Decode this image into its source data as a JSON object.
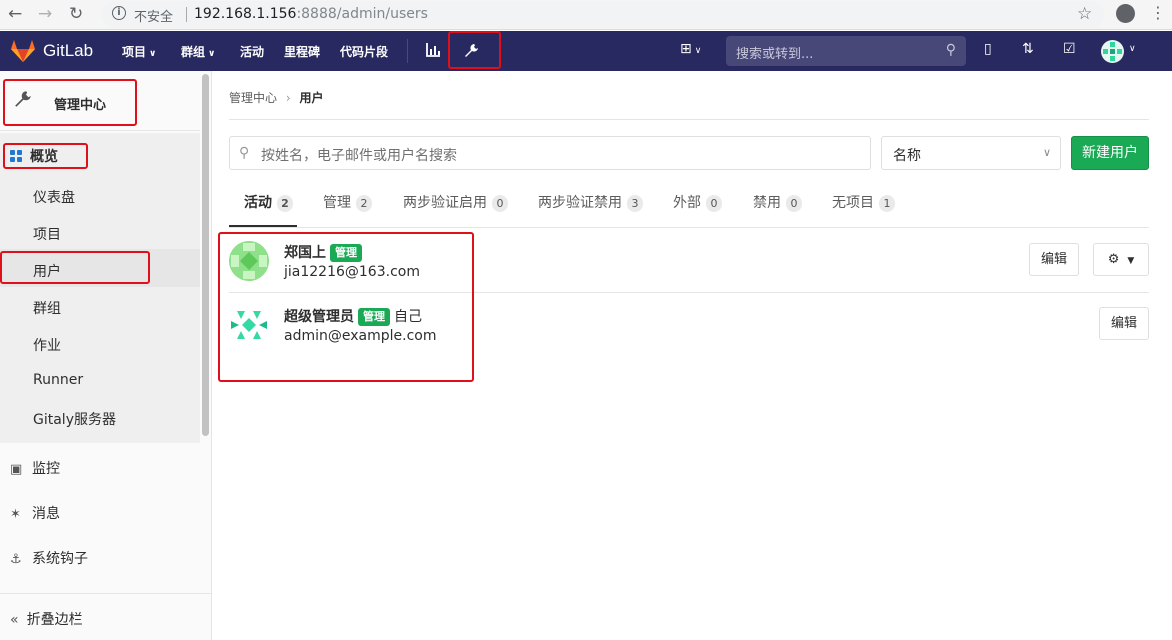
{
  "browser": {
    "back_icon": "arrow-left-icon",
    "forward_icon": "arrow-right-icon",
    "reload_icon": "reload-icon",
    "security_label": "不安全",
    "url_host": "192.168.1.156",
    "url_rest": ":8888/admin/users"
  },
  "header": {
    "brand": "GitLab",
    "nav": [
      {
        "label": "项目"
      },
      {
        "label": "群组"
      },
      {
        "label": "活动"
      },
      {
        "label": "里程碑"
      },
      {
        "label": "代码片段"
      }
    ],
    "search_placeholder": "搜索或转到..."
  },
  "sidebar": {
    "title": "管理中心",
    "overview": "概览",
    "sub_items": [
      {
        "label": "仪表盘"
      },
      {
        "label": "项目"
      },
      {
        "label": "用户"
      },
      {
        "label": "群组"
      },
      {
        "label": "作业"
      },
      {
        "label": "Runner"
      },
      {
        "label": "Gitaly服务器"
      }
    ],
    "items": [
      {
        "label": "监控"
      },
      {
        "label": "消息"
      },
      {
        "label": "系统钩子"
      }
    ],
    "collapse": "折叠边栏"
  },
  "breadcrumb": {
    "parent": "管理中心",
    "current": "用户"
  },
  "filter": {
    "search_placeholder": "按姓名，电子邮件或用户名搜索",
    "sort_value": "名称",
    "new_user": "新建用户"
  },
  "tabs": [
    {
      "label": "活动",
      "count": "2"
    },
    {
      "label": "管理",
      "count": "2"
    },
    {
      "label": "两步验证启用",
      "count": "0"
    },
    {
      "label": "两步验证禁用",
      "count": "3"
    },
    {
      "label": "外部",
      "count": "0"
    },
    {
      "label": "禁用",
      "count": "0"
    },
    {
      "label": "无项目",
      "count": "1"
    }
  ],
  "users": [
    {
      "name": "郑国上",
      "badge": "管理",
      "self": "",
      "email": "jia12216@163.com",
      "edit": "编辑"
    },
    {
      "name": "超级管理员",
      "badge": "管理",
      "self": "自己",
      "email": "admin@example.com",
      "edit": "编辑"
    }
  ],
  "colors": {
    "header": "#292961",
    "accent": "#1aaa55",
    "highlight": "#e0101a"
  }
}
